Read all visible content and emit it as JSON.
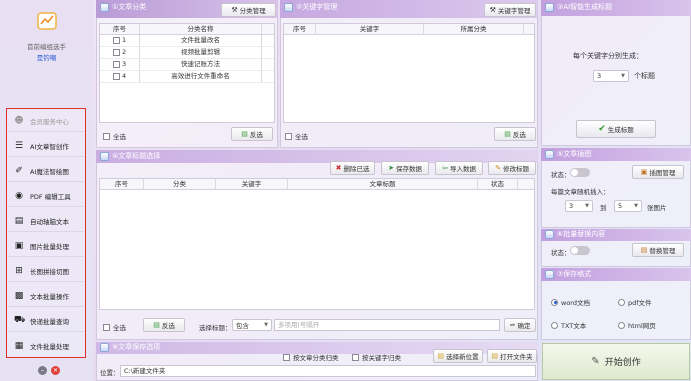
{
  "app": {
    "name": "首前编组选手",
    "user": "是钓嘲"
  },
  "sidebar": {
    "header": "会员服务中心",
    "items": [
      {
        "label": "AI文章智创作",
        "icon": "list-icon"
      },
      {
        "label": "AI魔法智绘图",
        "icon": "brush-icon"
      },
      {
        "label": "PDF 编辑工具",
        "icon": "pdf-icon"
      },
      {
        "label": "自动轴脑文本",
        "icon": "doc-icon"
      },
      {
        "label": "图片批量处理",
        "icon": "image-icon"
      },
      {
        "label": "长图拼接切图",
        "icon": "crop-icon"
      },
      {
        "label": "文本批量操作",
        "icon": "text-icon"
      },
      {
        "label": "快递批量查询",
        "icon": "truck-icon"
      },
      {
        "label": "文件批量处理",
        "icon": "file-icon"
      }
    ]
  },
  "category_panel": {
    "title": "①文章分类",
    "manage_button": "分类管理",
    "columns": [
      "序号",
      "分类名称"
    ],
    "rows": [
      {
        "no": "1",
        "name": "文件批量改名"
      },
      {
        "no": "2",
        "name": "视频批量剪辑"
      },
      {
        "no": "3",
        "name": "快速记账方法"
      },
      {
        "no": "4",
        "name": "高效进行文件重命名"
      }
    ],
    "select_all": "全选",
    "invert_button": "反选"
  },
  "keyword_panel": {
    "title": "②关键字管理",
    "manage_button": "关键字管理",
    "columns": [
      "序号",
      "关键字",
      "所属分类"
    ],
    "select_all": "全选",
    "invert_button": "反选"
  },
  "ai_title_panel": {
    "title": "③AI智能生成标题",
    "per_keyword_label": "每个关键字分别生成：",
    "count_value": "3",
    "count_unit": "个标题",
    "generate_button": "生成标题"
  },
  "title_select_panel": {
    "title": "④文章标题选择",
    "delete_button": "删除已选",
    "save_button": "保存数据",
    "import_button": "导入数据",
    "edit_button": "修改标题",
    "columns": [
      "序号",
      "分类",
      "关键字",
      "文章标题",
      "状态"
    ],
    "select_all": "全选",
    "invert_button": "反选",
    "filter_label": "选择标题：",
    "filter_mode": "包含",
    "filter_placeholder": "多项用|号隔开",
    "confirm_button": "确定"
  },
  "image_insert_panel": {
    "title": "⑤文章插图",
    "status_label": "状态：",
    "manage_button": "插图管理",
    "random_label": "每篇文章随机插入：",
    "from_value": "3",
    "to_label": "到",
    "to_value": "5",
    "unit": "张图片"
  },
  "replace_panel": {
    "title": "⑥批量替换内容",
    "status_label": "状态：",
    "manage_button": "替换管理"
  },
  "save_format_panel": {
    "title": "⑦保存格式",
    "options": [
      "word文档",
      "pdf文件",
      "TXT文本",
      "html网页"
    ],
    "selected": "word文档"
  },
  "save_options_panel": {
    "title": "⑧文章保存选项",
    "by_category": "按文章分类归类",
    "by_keyword": "按关键字归类",
    "choose_location_button": "选择新位置",
    "open_folder_button": "打开文件夹",
    "location_label": "位置：",
    "location_value": "C:\\新建文件夹"
  },
  "start_button": "开始创作",
  "colors": {
    "accent_red": "#e0302a",
    "title_bar": "#c9a8e0"
  }
}
